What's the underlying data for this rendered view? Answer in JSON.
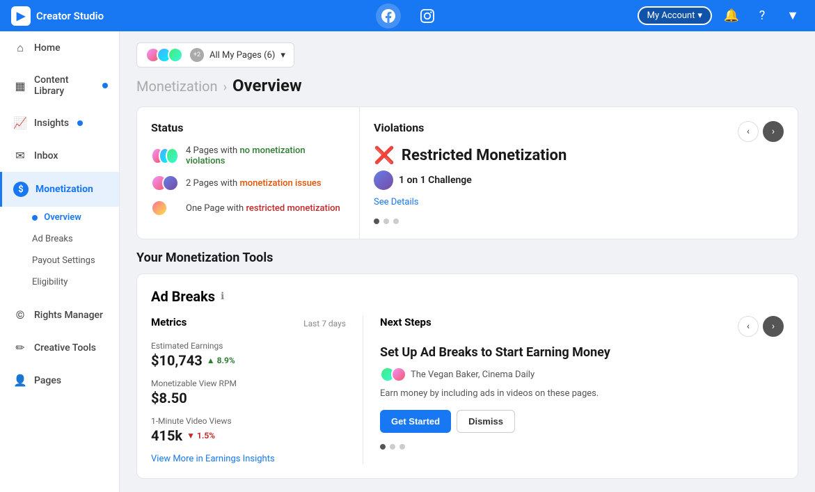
{
  "topbar": {
    "brand": "Creator Studio",
    "facebook_label": "Facebook",
    "instagram_label": "Instagram",
    "account_label": "My Account",
    "notifications_icon": "🔔",
    "help_icon": "?",
    "expand_icon": "▼"
  },
  "sidebar": {
    "items": [
      {
        "id": "home",
        "label": "Home",
        "icon": "⌂",
        "badge": false
      },
      {
        "id": "content-library",
        "label": "Content Library",
        "icon": "▦",
        "badge": true
      },
      {
        "id": "insights",
        "label": "Insights",
        "icon": "📈",
        "badge": true
      },
      {
        "id": "inbox",
        "label": "Inbox",
        "icon": "✉",
        "badge": false
      },
      {
        "id": "monetization",
        "label": "Monetization",
        "icon": "💲",
        "badge": false,
        "active": true
      }
    ],
    "monetization_subitems": [
      {
        "id": "overview",
        "label": "Overview",
        "active": true
      },
      {
        "id": "ad-breaks",
        "label": "Ad Breaks",
        "active": false
      },
      {
        "id": "payout-settings",
        "label": "Payout Settings",
        "active": false
      },
      {
        "id": "eligibility",
        "label": "Eligibility",
        "active": false
      }
    ],
    "bottom_items": [
      {
        "id": "rights",
        "label": "Rights Manager",
        "icon": "©"
      },
      {
        "id": "creative-tools",
        "label": "Creative Tools",
        "icon": "✏"
      },
      {
        "id": "pages",
        "label": "Pages",
        "icon": "👤"
      }
    ]
  },
  "page_selector": {
    "label": "All My Pages (6)",
    "count": 6
  },
  "breadcrumb": {
    "parent": "Monetization",
    "separator": ">",
    "current": "Overview"
  },
  "status_panel": {
    "title": "Status",
    "rows": [
      {
        "text_prefix": "4 Pages with ",
        "link_text": "no monetization violations",
        "link_class": "green"
      },
      {
        "text_prefix": "2 Pages with ",
        "link_text": "monetization issues",
        "link_class": "orange"
      },
      {
        "text_prefix": "One Page with ",
        "link_text": "restricted monetization",
        "link_class": "red"
      }
    ]
  },
  "violations_panel": {
    "title": "Violations",
    "icon": "❌",
    "violation_title": "Restricted Monetization",
    "sub_label": "1 on 1 Challenge",
    "see_details": "See Details",
    "dots": [
      true,
      false,
      false
    ]
  },
  "monetization_tools": {
    "section_title": "Your Monetization Tools",
    "ad_breaks": {
      "title": "Ad Breaks",
      "metrics_title": "Metrics",
      "period": "Last 7 days",
      "metrics": [
        {
          "label": "Estimated Earnings",
          "value": "$10,743",
          "change": "+8.9%",
          "direction": "up"
        },
        {
          "label": "Monetizable View RPM",
          "value": "$8.50",
          "change": null,
          "direction": null
        },
        {
          "label": "1-Minute Video Views",
          "value": "415k",
          "change": "-1.5%",
          "direction": "down"
        }
      ],
      "view_more": "View More in Earnings Insights",
      "next_steps_title": "Next Steps",
      "step_title": "Set Up Ad Breaks to Start Earning Money",
      "step_pages": "The Vegan Baker, Cinema Daily",
      "step_desc": "Earn money by including ads in videos on these pages.",
      "btn_primary": "Get Started",
      "btn_dismiss": "Dismiss",
      "dots": [
        true,
        false,
        false
      ]
    }
  }
}
